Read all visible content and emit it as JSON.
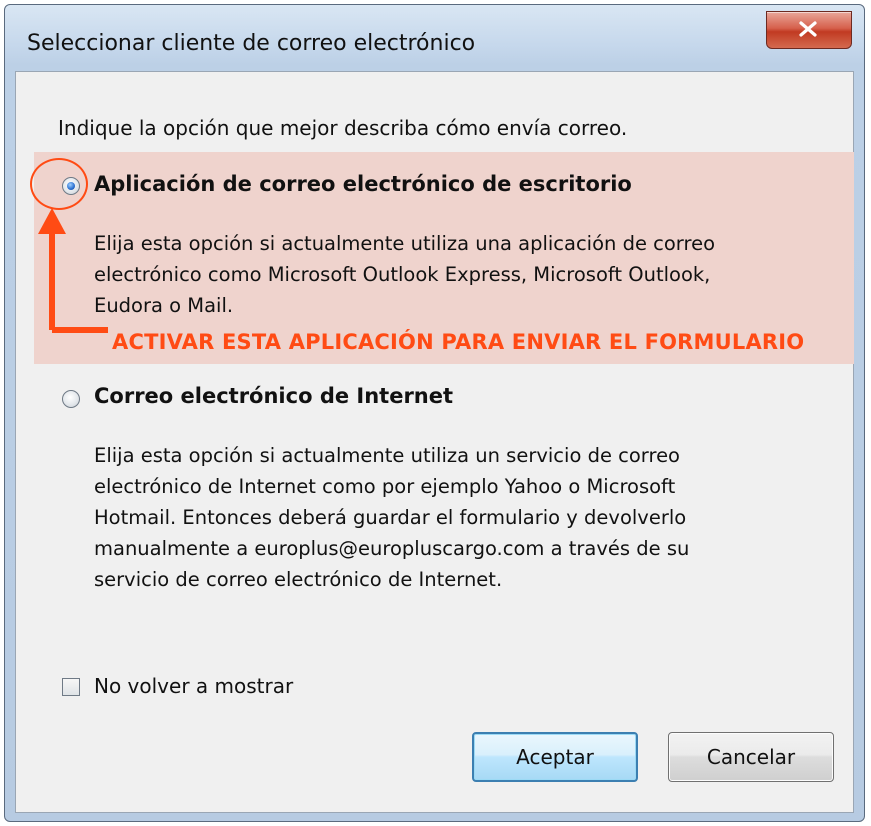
{
  "window": {
    "title": "Seleccionar cliente de correo electrónico",
    "close_icon": "close-icon"
  },
  "dialog": {
    "instruction": "Indique la opción que mejor describa cómo envía correo.",
    "options": [
      {
        "label": "Aplicación de correo electrónico de escritorio",
        "selected": true,
        "description_lines": [
          "Elija esta opción si actualmente utiliza una aplicación de correo",
          "electrónico como Microsoft Outlook Express, Microsoft Outlook,",
          "Eudora o Mail."
        ]
      },
      {
        "label": "Correo electrónico de Internet",
        "selected": false,
        "description_lines": [
          "Elija esta opción si actualmente utiliza un servicio de correo",
          "electrónico de Internet como por ejemplo Yahoo o Microsoft",
          "Hotmail. Entonces deberá guardar el formulario y devolverlo",
          "manualmente a europlus@europluscargo.com a través de su",
          "servicio de correo electrónico de Internet."
        ]
      }
    ],
    "annotation": "ACTIVAR ESTA APLICACIÓN  PARA ENVIAR EL FORMULARIO",
    "dont_show_again": {
      "label": "No volver a mostrar",
      "checked": false
    },
    "buttons": {
      "ok": "Aceptar",
      "cancel": "Cancelar"
    }
  },
  "colors": {
    "annotation": "#ff4b14",
    "highlight": "#efd3cd",
    "close_button": "#c13a22",
    "default_button_border": "#3c7fb1"
  }
}
